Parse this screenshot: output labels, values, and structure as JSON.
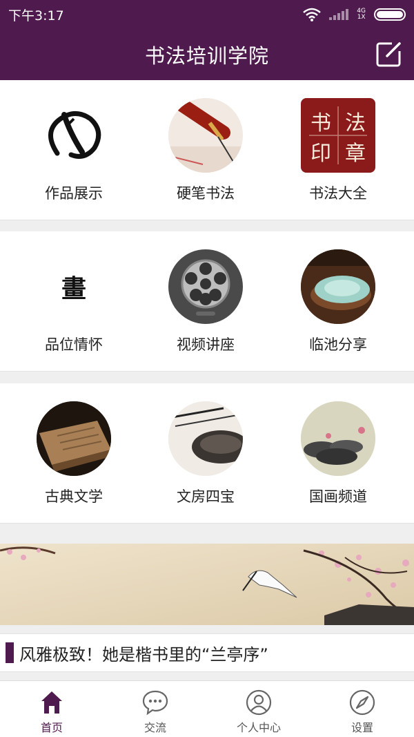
{
  "status": {
    "time": "下午3:17",
    "network_top": "4G",
    "network_bottom": "1X"
  },
  "header": {
    "title": "书法培训学院"
  },
  "grid": [
    {
      "label": "作品展示",
      "icon": "ink-circle-icon"
    },
    {
      "label": "硬笔书法",
      "icon": "fountain-pen-icon"
    },
    {
      "label": "书法大全",
      "icon": "red-seal-icon"
    },
    {
      "label": "品位情怀",
      "icon": "calligraphy-character-icon"
    },
    {
      "label": "视频讲座",
      "icon": "film-reel-icon"
    },
    {
      "label": "临池分享",
      "icon": "ink-stone-dish-icon"
    },
    {
      "label": "古典文学",
      "icon": "ancient-book-icon"
    },
    {
      "label": "文房四宝",
      "icon": "brush-inkstone-icon"
    },
    {
      "label": "国画频道",
      "icon": "lotus-painting-icon"
    }
  ],
  "seal_text": "书法印章",
  "calligraphy_char": "畫",
  "headline": "风雅极致！她是楷书里的“兰亭序”",
  "tabs": [
    {
      "label": "首页",
      "icon": "home-icon",
      "active": true
    },
    {
      "label": "交流",
      "icon": "chat-bubble-icon",
      "active": false
    },
    {
      "label": "个人中心",
      "icon": "user-icon",
      "active": false
    },
    {
      "label": "设置",
      "icon": "compass-icon",
      "active": false
    }
  ],
  "colors": {
    "accent": "#4f1b4e",
    "background": "#efefef"
  }
}
